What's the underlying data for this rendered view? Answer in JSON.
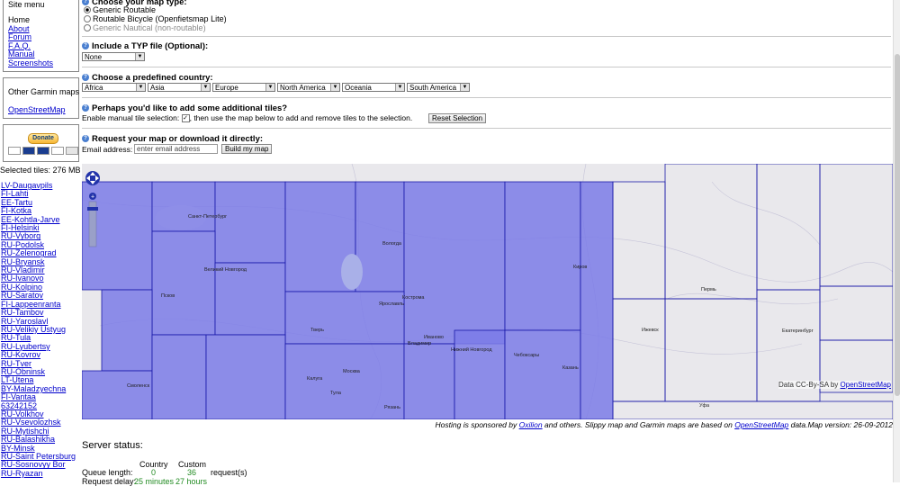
{
  "sidebar": {
    "menu_title": "Site menu",
    "menu_items": [
      "Home",
      "About",
      "Forum",
      "F.A.Q.",
      "Manual",
      "Screenshots"
    ],
    "other_maps_title": "Other Garmin maps",
    "other_maps_link": "OpenStreetMap",
    "donate_label": "Donate",
    "selected_tiles": "Selected tiles: 276 MB",
    "tiles": [
      "LV-Daugavpils",
      "FI-Lahti",
      "EE-Tartu",
      "FI-Kotka",
      "EE-Kohtla-Jarve",
      "FI-Helsinki",
      "RU-Vyborg",
      "RU-Podolsk",
      "RU-Zelenograd",
      "RU-Bryansk",
      "RU-Vladimir",
      "RU-Ivanovo",
      "RU-Kolpino",
      "RU-Saratov",
      "FI-Lappeenranta",
      "RU-Tambov",
      "RU-Yaroslavl",
      "RU-Velikiy Ustyug",
      "RU-Tula",
      "RU-Lyubertsy",
      "RU-Kovrov",
      "RU-Tver",
      "RU-Obninsk",
      "LT-Utena",
      "BY-Maladzyechna",
      "FI-Vantaa",
      "63242152",
      "RU-Volkhov",
      "RU-Vsevolozhsk",
      "RU-Mytishchi",
      "RU-Balashikha",
      "BY-Minsk",
      "RU-Saint Petersburg",
      "RU-Sosnovyy Bor",
      "RU-Ryazan"
    ]
  },
  "form": {
    "q1": "Choose your map type:",
    "map_types": [
      {
        "label": "Generic Routable",
        "selected": true
      },
      {
        "label": "Routable Bicycle (Openfietsmap Lite)",
        "selected": false
      },
      {
        "label": "Generic Nautical (non-routable)",
        "selected": false
      }
    ],
    "q2": "Include a TYP file (Optional):",
    "typ_value": "None",
    "q3": "Choose a predefined country:",
    "regions": [
      "Africa",
      "Asia",
      "Europe",
      "North America",
      "Oceania",
      "South America"
    ],
    "q4": "Perhaps you'd like to add some additional tiles?",
    "manual_before": "Enable manual tile selection:",
    "manual_after": ", then use the map below to add and remove tiles to the selection.",
    "reset_label": "Reset Selection",
    "q5": "Request your map or download it directly:",
    "email_label": "Email address:",
    "email_placeholder": "enter email address",
    "build_label": "Build my map"
  },
  "map": {
    "attribution_prefix": "Data CC-By-SA by",
    "attribution_link": "OpenStreetMap",
    "cities": [
      "Санкт-Петербург",
      "Великий Новгород",
      "Псков",
      "Вологда",
      "Ярославль",
      "Кострома",
      "Тверь",
      "Нижний Новгород",
      "Чебоксары",
      "Казань",
      "Киров",
      "Ижевск",
      "Пермь",
      "Екатеринбург",
      "Уфа",
      "Рязань",
      "Владимир",
      "Москва",
      "Тула",
      "Калуга",
      "Смоленск",
      "Иваново"
    ],
    "selection_color": "#7b7be8",
    "tile_border_color": "#1a1aa8"
  },
  "credit": {
    "prefix": "Hosting is sponsored by",
    "sponsor": "Oxilion",
    "middle": "and others. Slippy map and Garmin maps are based on",
    "osm": "OpenStreetMap",
    "suffix": "data.Map version: 26-09-2012"
  },
  "server": {
    "title": "Server status:",
    "col_country": "Country",
    "col_custom": "Custom",
    "queue_label": "Queue length:",
    "queue_country": "0",
    "queue_custom": "36",
    "queue_unit": "request(s)",
    "delay_label": "Request delay:",
    "delay_country": "25 minutes",
    "delay_custom": "27 hours"
  }
}
